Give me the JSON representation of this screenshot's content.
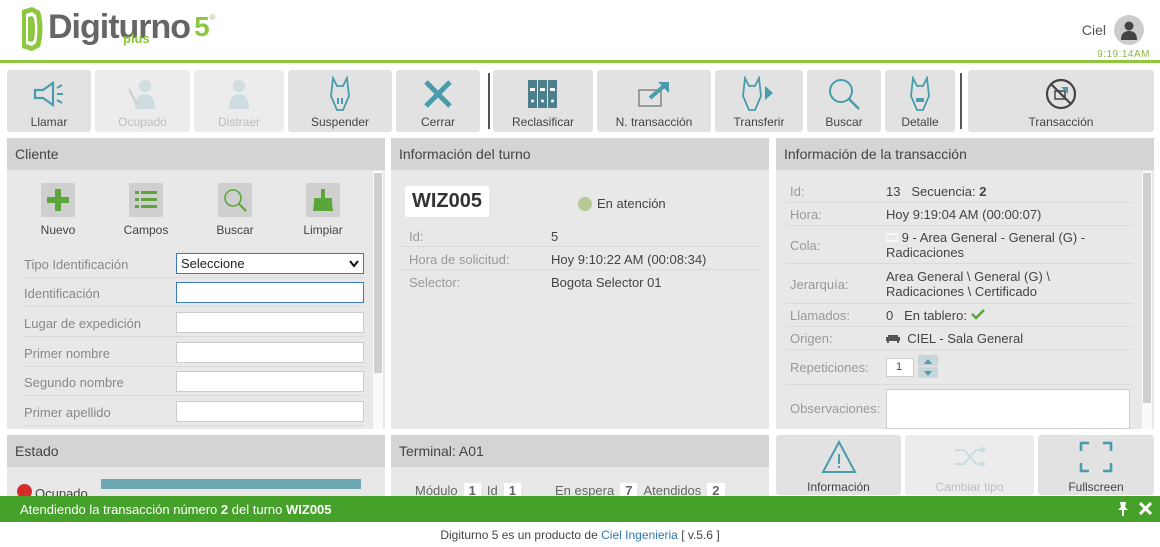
{
  "brand": {
    "name": "Digiturno",
    "version_mark": "5",
    "sub": "plus",
    "reg": "®"
  },
  "user": {
    "name": "Ciel",
    "clock": "9:19:14AM"
  },
  "toolbar": [
    {
      "label": "Llamar",
      "icon": "megaphone-icon",
      "enabled": true
    },
    {
      "label": "Ocupado",
      "icon": "busy-user-icon",
      "enabled": false
    },
    {
      "label": "Distraer",
      "icon": "user-icon",
      "enabled": false
    },
    {
      "label": "Suspender",
      "icon": "pause-ticket-icon",
      "enabled": true
    },
    {
      "label": "Cerrar",
      "icon": "close-x-icon",
      "enabled": true
    },
    {
      "label": "Reclasificar",
      "icon": "binders-icon",
      "enabled": true
    },
    {
      "label": "N. transacción",
      "icon": "new-transaction-icon",
      "enabled": true
    },
    {
      "label": "Transferir",
      "icon": "transfer-ticket-icon",
      "enabled": true
    },
    {
      "label": "Buscar",
      "icon": "magnifier-icon",
      "enabled": true
    },
    {
      "label": "Detalle",
      "icon": "detail-ticket-icon",
      "enabled": true
    },
    {
      "label": "Transacción",
      "icon": "no-transaction-icon",
      "enabled": true
    }
  ],
  "cliente": {
    "title": "Cliente",
    "actions": [
      "Nuevo",
      "Campos",
      "Buscar",
      "Limpiar"
    ],
    "fields": [
      {
        "label": "Tipo Identificación",
        "value": "Seleccione"
      },
      {
        "label": "Identificación",
        "value": ""
      },
      {
        "label": "Lugar de expedición",
        "value": ""
      },
      {
        "label": "Primer nombre",
        "value": ""
      },
      {
        "label": "Segundo nombre",
        "value": ""
      },
      {
        "label": "Primer apellido",
        "value": ""
      }
    ]
  },
  "turno": {
    "title": "Información del turno",
    "ticket": "WIZ005",
    "status": "En atención",
    "status_color": "#b5c996",
    "rows": [
      {
        "k": "Id:",
        "v": "5"
      },
      {
        "k": "Hora de solicitud:",
        "v": "Hoy 9:10:22 AM (00:08:34)"
      },
      {
        "k": "Selector:",
        "v": "Bogota Selector 01"
      }
    ]
  },
  "transaccion": {
    "title": "Información de la transacción",
    "id_label": "Id:",
    "id": "13",
    "seq_label": "Secuencia:",
    "seq": "2",
    "hora_label": "Hora:",
    "hora": "Hoy 9:19:04 AM (00:00:07)",
    "cola_label": "Cola:",
    "cola": "9 - Area General - General (G) - Radicaciones",
    "jer_label": "Jerarquía:",
    "jer": "Area General \\ General (G) \\ Radicaciones \\ Certificado",
    "llam_label": "Llamados:",
    "llam": "0",
    "tablero_label": "En tablero:",
    "origen_label": "Origen:",
    "origen": "CIEL - Sala General",
    "rep_label": "Repeticiones:",
    "rep": "1",
    "obs_label": "Observaciones:"
  },
  "estado": {
    "title": "Estado",
    "value": "Ocupado",
    "color": "#d62b2b"
  },
  "terminal": {
    "title": "Terminal: A01",
    "modulo_label": "Módulo",
    "modulo": "1",
    "id_label": "Id",
    "id": "1",
    "espera_label": "En espera",
    "espera": "7",
    "atendidos_label": "Atendidos",
    "atendidos": "2"
  },
  "bottom_buttons": [
    {
      "label": "Información",
      "icon": "info-triangle-icon",
      "enabled": true
    },
    {
      "label": "Cambiar tipo",
      "icon": "shuffle-icon",
      "enabled": false
    },
    {
      "label": "Fullscreen",
      "icon": "fullscreen-icon",
      "enabled": true
    }
  ],
  "statusbar": {
    "prefix": "Atendiendo la transacción número",
    "num": "2",
    "mid": "del turno",
    "ticket": "WIZ005"
  },
  "footer": {
    "text": "Digiturno 5 es un producto de",
    "link": "Ciel Ingenieria",
    "version": "[ v.5.6 ]"
  },
  "colors": {
    "accent": "#8dc63f",
    "statusbar": "#45a12a",
    "icon_teal": "#4a9bab"
  }
}
